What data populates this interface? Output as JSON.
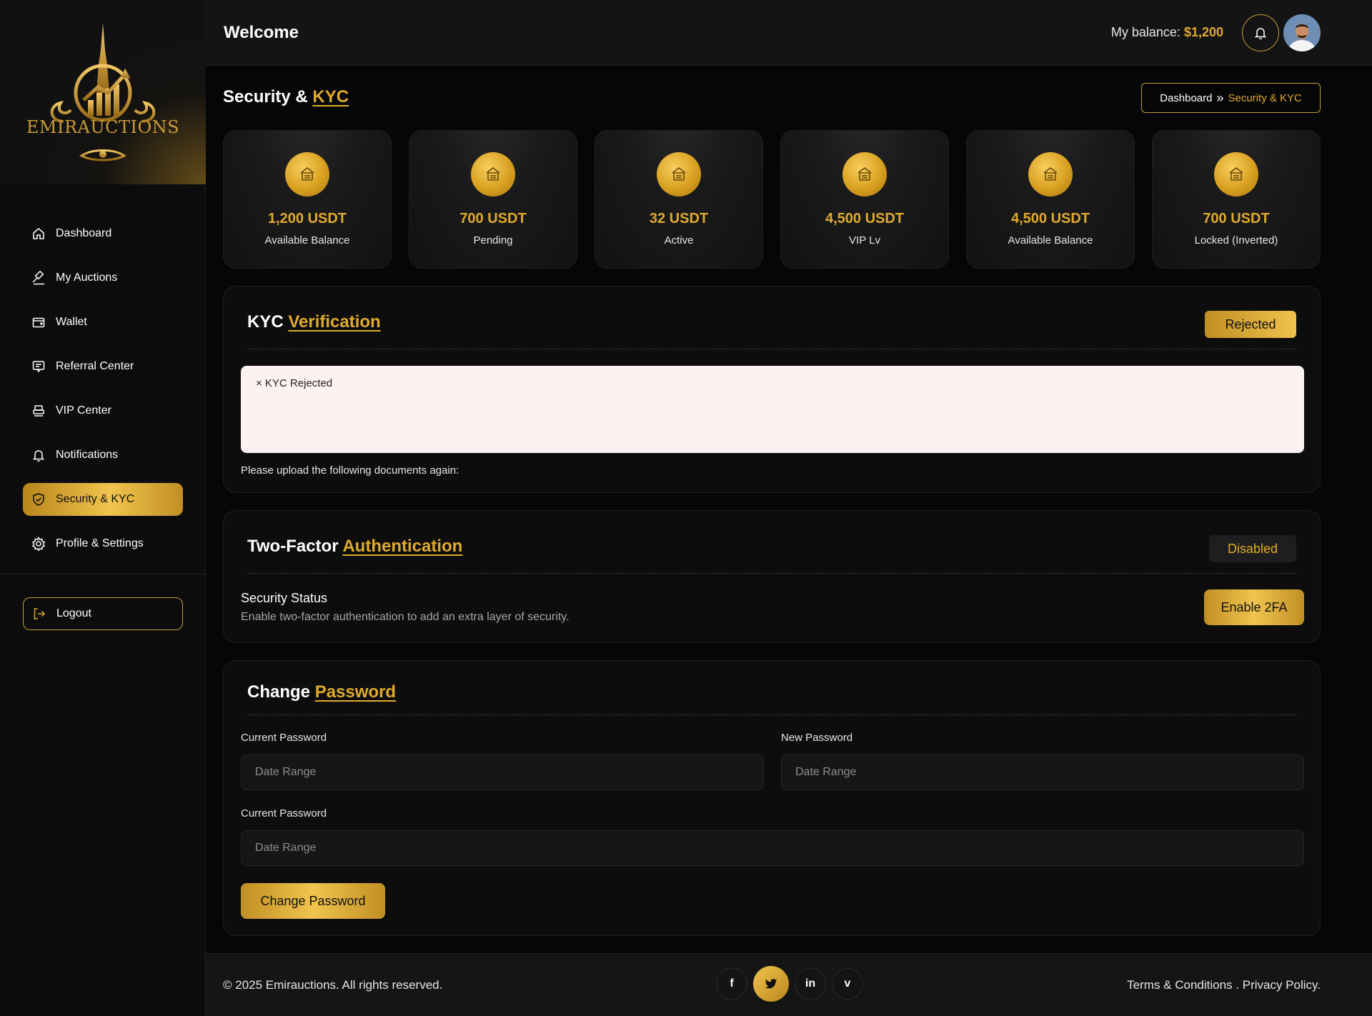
{
  "brand": {
    "name": "EMIRAUCTIONS"
  },
  "colors": {
    "accent": "#e0aa2e",
    "background": "#050608",
    "panel": "#0d0d0e",
    "rejected_box": "#fdf2f2"
  },
  "header": {
    "welcome": "Welcome",
    "balance_label": "My balance:",
    "balance_value": "$1,200",
    "bell_icon": "bell-icon",
    "avatar": "user-avatar"
  },
  "sidebar": {
    "items": [
      {
        "label": "Dashboard",
        "icon": "home-icon"
      },
      {
        "label": "My Auctions",
        "icon": "gavel-icon"
      },
      {
        "label": "Wallet",
        "icon": "wallet-icon"
      },
      {
        "label": "Referral Center",
        "icon": "referral-icon"
      },
      {
        "label": "VIP Center",
        "icon": "vip-icon"
      },
      {
        "label": "Notifications",
        "icon": "bell-icon"
      },
      {
        "label": "Security & KYC",
        "icon": "shield-icon",
        "active": true
      },
      {
        "label": "Profile & Settings",
        "icon": "gear-icon"
      }
    ],
    "logout": "Logout"
  },
  "page": {
    "title_part1": "Security &",
    "title_part2": "KYC",
    "breadcrumb": {
      "home": "Dashboard",
      "separator": "»",
      "current": "Security & KYC"
    }
  },
  "stats": [
    {
      "value": "1,200 USDT",
      "label": "Available Balance"
    },
    {
      "value": "700 USDT",
      "label": "Pending"
    },
    {
      "value": "32 USDT",
      "label": "Active"
    },
    {
      "value": "4,500 USDT",
      "label": "VIP Lv"
    },
    {
      "value": "4,500 USDT",
      "label": "Available Balance"
    },
    {
      "value": "700 USDT",
      "label": "Locked (Inverted)"
    }
  ],
  "kyc": {
    "title_part1": "KYC",
    "title_part2": "Verification",
    "status": "Rejected",
    "message": "× KYC Rejected",
    "note": "Please upload the following documents again:"
  },
  "twofa": {
    "title_part1": "Two-Factor",
    "title_part2": "Authentication",
    "status": "Disabled",
    "security_status_title": "Security Status",
    "security_status_desc": "Enable two-factor authentication to add an extra layer of security.",
    "enable_button": "Enable 2FA"
  },
  "password": {
    "title_part1": "Change",
    "title_part2": "Password",
    "fields": [
      {
        "label": "Current Password",
        "placeholder": "Date Range"
      },
      {
        "label": "New Password",
        "placeholder": "Date Range"
      },
      {
        "label": "Current Password",
        "placeholder": "Date Range"
      }
    ],
    "submit": "Change Password"
  },
  "footer": {
    "copyright": "© 2025 Emirauctions. All rights reserved.",
    "legal": "Terms & Conditions . Privacy Policy.",
    "social": [
      {
        "icon": "facebook-icon",
        "glyph": "f"
      },
      {
        "icon": "twitter-icon",
        "glyph": "🐦"
      },
      {
        "icon": "linkedin-icon",
        "glyph": "in"
      },
      {
        "icon": "vimeo-icon",
        "glyph": "v"
      }
    ]
  }
}
